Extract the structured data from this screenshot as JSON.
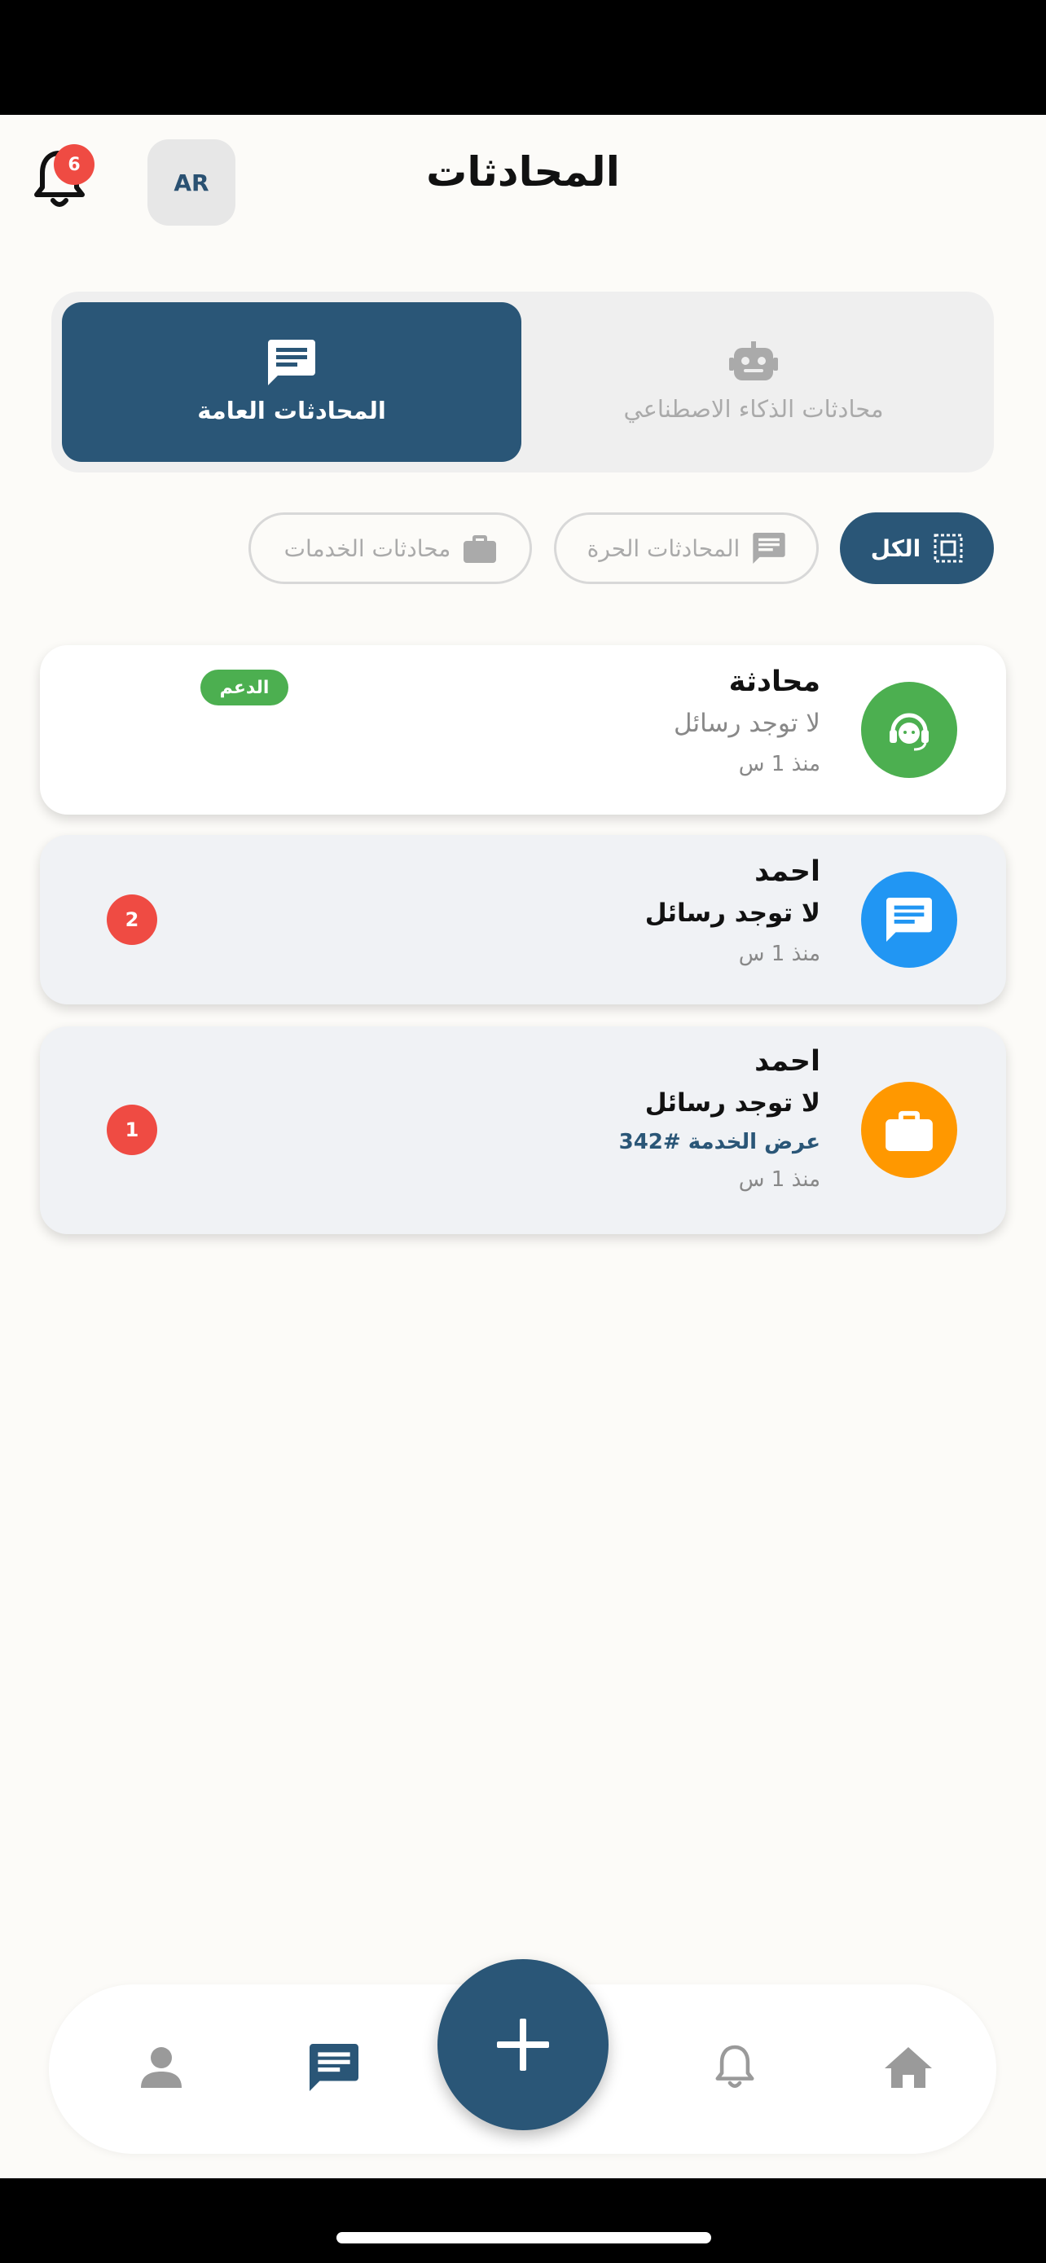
{
  "header": {
    "title": "المحادثات",
    "language_button": "AR",
    "notification_count": "6"
  },
  "segments": {
    "general_label": "المحادثات العامة",
    "ai_label": "محادثات الذكاء الاصطناعي",
    "active": "general"
  },
  "filters": {
    "all_label": "الكل",
    "free_label": "المحادثات الحرة",
    "services_label": "محادثات الخدمات",
    "active": "all"
  },
  "conversations": [
    {
      "name": "محادثة",
      "last_message": "لا توجد رسائل",
      "time": "منذ 1 س",
      "badge": "الدعم",
      "icon": "support-agent-icon",
      "color": "#4caf50"
    },
    {
      "name": "احمد",
      "last_message": "لا توجد رسائل",
      "time": "منذ 1 س",
      "unread": "2",
      "icon": "chat-icon",
      "color": "#2196f3"
    },
    {
      "name": "احمد",
      "last_message": "لا توجد رسائل",
      "reference": "عرض الخدمة #342",
      "time": "منذ 1 س",
      "unread": "1",
      "icon": "briefcase-icon",
      "color": "#ff9800"
    }
  ],
  "bottom_nav": {
    "items": [
      "profile-icon",
      "chat-icon",
      "add-icon",
      "bell-icon",
      "home-icon"
    ],
    "active": "chat-icon"
  },
  "colors": {
    "primary": "#2a5677",
    "badge_red": "#ef4b43",
    "support_green": "#4caf50"
  }
}
